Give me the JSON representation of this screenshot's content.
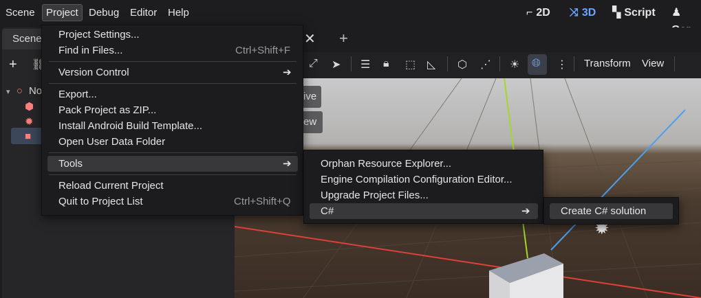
{
  "menubar": {
    "items": [
      "Scene",
      "Project",
      "Debug",
      "Editor",
      "Help"
    ],
    "modes": [
      {
        "label": "2D",
        "icon": "2d-icon"
      },
      {
        "label": "3D",
        "icon": "3d-icon"
      },
      {
        "label": "Script",
        "icon": "script-icon"
      },
      {
        "label": "Gar",
        "icon": "game-icon"
      }
    ]
  },
  "left_dock": {
    "tab_label": "Scene",
    "tree": [
      {
        "label": "No",
        "icon": "node3d-icon"
      },
      {
        "label": "",
        "icon": "mesh-instance-icon"
      },
      {
        "label": "",
        "icon": "light-icon"
      },
      {
        "label": "",
        "icon": "camera-icon"
      }
    ]
  },
  "editor": {
    "toolbar_menus": [
      "Transform",
      "View"
    ],
    "viewport_chips": [
      "ive",
      "ew"
    ]
  },
  "project_menu": {
    "items": [
      {
        "label": "Project Settings...",
        "shortcut": ""
      },
      {
        "label": "Find in Files...",
        "shortcut": "Ctrl+Shift+F"
      },
      {
        "label": "Version Control",
        "submenu": true
      },
      {
        "label": "Export...",
        "shortcut": ""
      },
      {
        "label": "Pack Project as ZIP...",
        "shortcut": ""
      },
      {
        "label": "Install Android Build Template...",
        "shortcut": ""
      },
      {
        "label": "Open User Data Folder",
        "shortcut": ""
      },
      {
        "label": "Tools",
        "submenu": true
      },
      {
        "label": "Reload Current Project",
        "shortcut": ""
      },
      {
        "label": "Quit to Project List",
        "shortcut": "Ctrl+Shift+Q"
      }
    ]
  },
  "tools_menu": {
    "items": [
      {
        "label": "Orphan Resource Explorer..."
      },
      {
        "label": "Engine Compilation Configuration Editor..."
      },
      {
        "label": "Upgrade Project Files..."
      },
      {
        "label": "C#",
        "submenu": true
      }
    ]
  },
  "csharp_menu": {
    "items": [
      {
        "label": "Create C# solution"
      }
    ]
  },
  "colors": {
    "accent": "#6aa5ff",
    "menu_bg": "#1c1c1e",
    "highlight": "#38383b"
  }
}
